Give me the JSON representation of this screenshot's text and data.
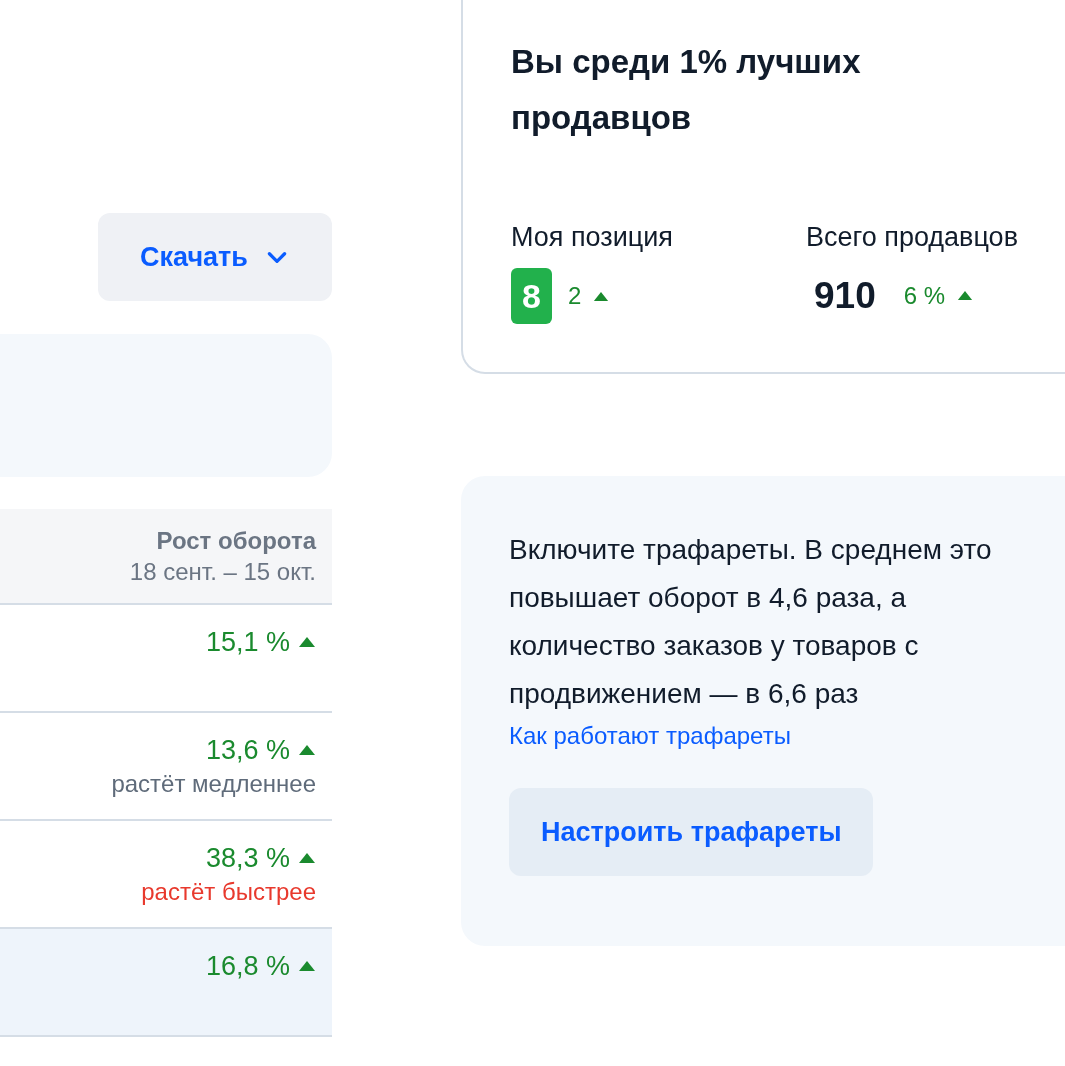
{
  "download_button": {
    "label": "Скачать"
  },
  "table": {
    "column": {
      "title": "Рост оборота",
      "period": "18 сент. – 15 окт."
    },
    "rows": [
      {
        "value": "15,1 %",
        "selected": false
      },
      {
        "value": "13,6 %",
        "note": "растёт медленнее",
        "color": "#5f6b7a",
        "selected": false
      },
      {
        "value": "38,3 %",
        "note": "растёт быстрее",
        "color": "#e8392d",
        "selected": false
      },
      {
        "value": "16,8 %",
        "selected": true
      }
    ]
  },
  "rank_card": {
    "title": "Вы среди 1% лучших продавцов",
    "stats": [
      {
        "kind": "badge",
        "label": "Моя позиция",
        "value": "8",
        "change": "2"
      },
      {
        "kind": "number",
        "label": "Всего продавцов",
        "value": "910",
        "change": "6 %"
      }
    ]
  },
  "promo_card": {
    "text": "Включите трафареты. В среднем это повышает оборот в 4,6 раза, а количество заказов у товаров с продвижением — в 6,6 раз",
    "link": "Как работают трафареты",
    "button": "Настроить трафареты"
  }
}
